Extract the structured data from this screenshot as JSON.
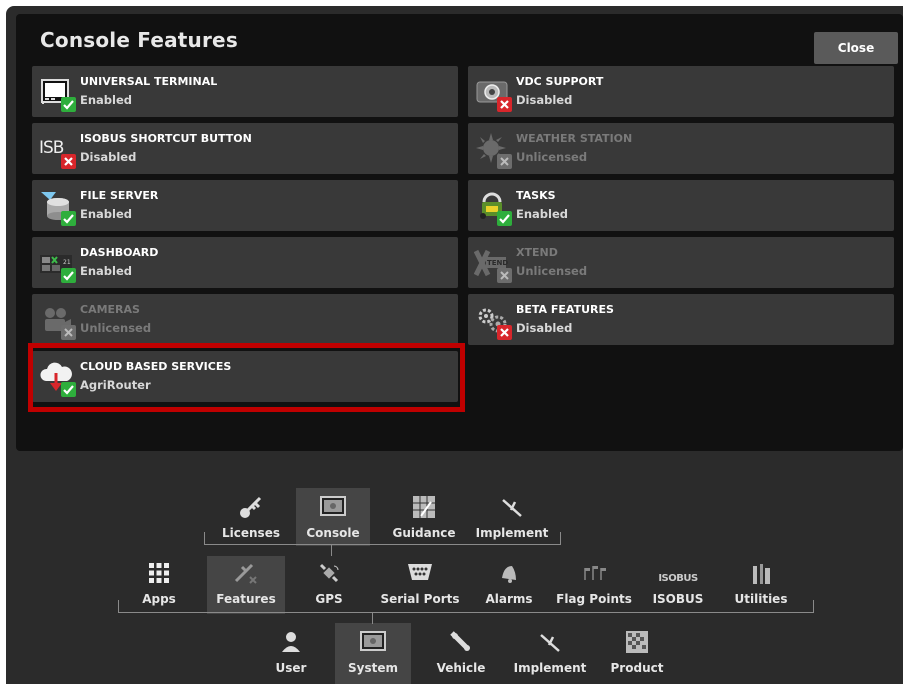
{
  "panel": {
    "title": "Console Features",
    "close_label": "Close"
  },
  "features": [
    {
      "name": "UNIVERSAL TERMINAL",
      "status": "Enabled",
      "icon": "universal-terminal-icon",
      "badge": "check"
    },
    {
      "name": "VDC SUPPORT",
      "status": "Disabled",
      "icon": "vdc-support-icon",
      "badge": "x"
    },
    {
      "name": "ISOBUS SHORTCUT BUTTON",
      "status": "Disabled",
      "icon": "isobus-shortcut-icon",
      "icon_text": "ISB",
      "badge": "x"
    },
    {
      "name": "WEATHER STATION",
      "status": "Unlicensed",
      "icon": "weather-station-icon",
      "badge": "grey-x"
    },
    {
      "name": "FILE SERVER",
      "status": "Enabled",
      "icon": "file-server-icon",
      "badge": "check"
    },
    {
      "name": "TASKS",
      "status": "Enabled",
      "icon": "tasks-icon",
      "badge": "check"
    },
    {
      "name": "DASHBOARD",
      "status": "Enabled",
      "icon": "dashboard-icon",
      "icon_text": "21",
      "badge": "check"
    },
    {
      "name": "XTEND",
      "status": "Unlicensed",
      "icon": "xtend-icon",
      "icon_text": "TEND",
      "badge": "grey-x"
    },
    {
      "name": "CAMERAS",
      "status": "Unlicensed",
      "icon": "cameras-icon",
      "badge": "grey-x"
    },
    {
      "name": "BETA FEATURES",
      "status": "Disabled",
      "icon": "beta-features-icon",
      "badge": "x"
    },
    {
      "name": "CLOUD BASED SERVICES",
      "status": "AgriRouter",
      "icon": "cloud-services-icon",
      "badge": "check"
    }
  ],
  "nav": {
    "level1": [
      {
        "label": "Licenses",
        "icon": "licenses-icon"
      },
      {
        "label": "Console",
        "icon": "console-icon",
        "selected": true
      },
      {
        "label": "Guidance",
        "icon": "guidance-icon"
      },
      {
        "label": "Implement",
        "icon": "implement-icon"
      }
    ],
    "level2": [
      {
        "label": "Apps",
        "icon": "apps-grid-icon"
      },
      {
        "label": "Features",
        "icon": "features-icon",
        "selected": true
      },
      {
        "label": "GPS",
        "icon": "gps-satellite-icon"
      },
      {
        "label": "Serial Ports",
        "icon": "serial-ports-icon"
      },
      {
        "label": "Alarms",
        "icon": "alarm-bell-icon"
      },
      {
        "label": "Flag Points",
        "icon": "flag-points-icon"
      },
      {
        "label": "ISOBUS",
        "icon": "isobus-icon",
        "icon_text": "ISOBUS"
      },
      {
        "label": "Utilities",
        "icon": "utilities-icon"
      }
    ],
    "level3": [
      {
        "label": "User",
        "icon": "user-icon"
      },
      {
        "label": "System",
        "icon": "system-icon",
        "selected": true
      },
      {
        "label": "Vehicle",
        "icon": "vehicle-icon"
      },
      {
        "label": "Implement",
        "icon": "implement-icon"
      },
      {
        "label": "Product",
        "icon": "product-icon"
      }
    ]
  },
  "colors": {
    "highlight": "#c00000",
    "enabled_badge": "#2eae3c",
    "disabled_badge": "#d8262b",
    "unlicensed_badge": "#6d6d6d"
  }
}
